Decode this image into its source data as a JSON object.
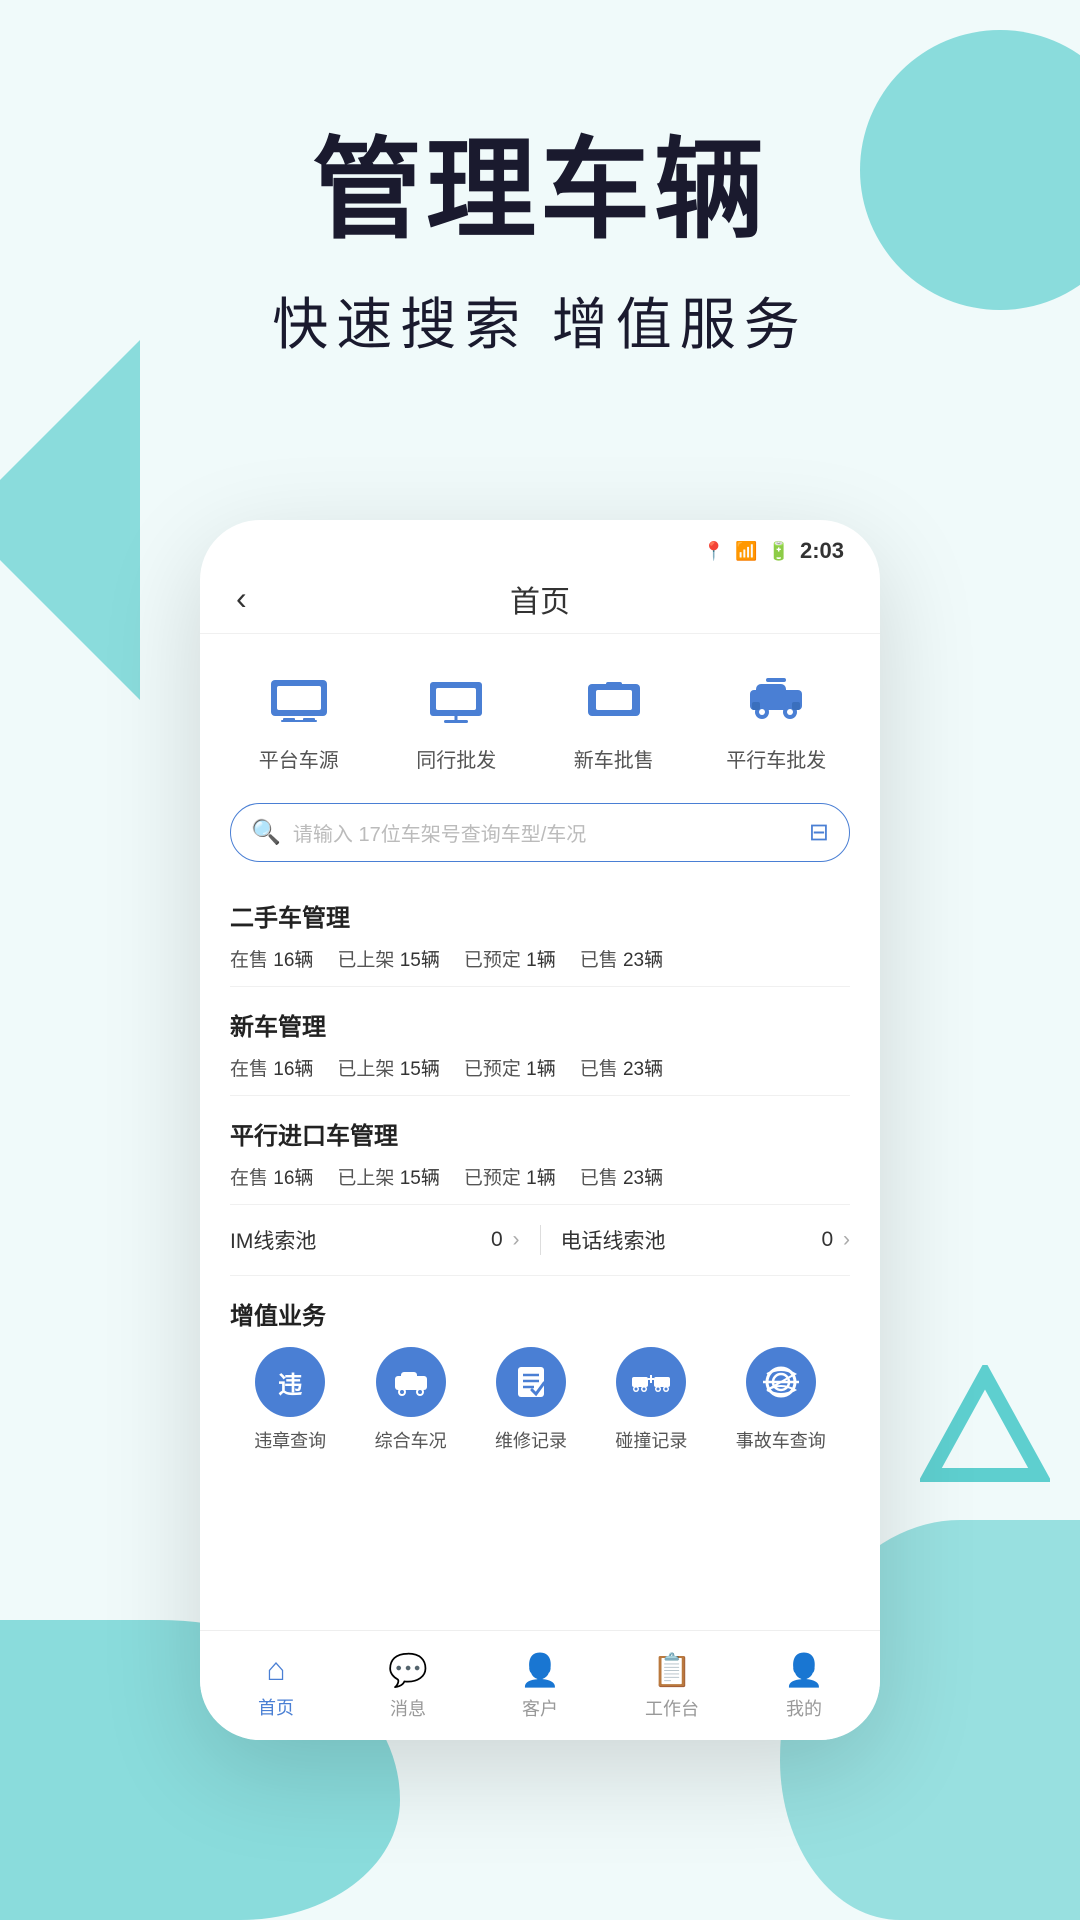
{
  "hero": {
    "title": "管理车辆",
    "subtitle": "快速搜索 增值服务"
  },
  "phone": {
    "statusBar": {
      "time": "2:03"
    },
    "navBar": {
      "title": "首页",
      "backLabel": "‹"
    },
    "quickAccess": [
      {
        "id": "platform-car",
        "label": "平台车源"
      },
      {
        "id": "peer-wholesale",
        "label": "同行批发"
      },
      {
        "id": "new-car-retail",
        "label": "新车批售"
      },
      {
        "id": "parallel-car-wholesale",
        "label": "平行车批发"
      }
    ],
    "searchBar": {
      "placeholder": "请输入 17位车架号查询车型/车况"
    },
    "sections": {
      "usedCar": {
        "title": "二手车管理",
        "stats": [
          {
            "label": "在售",
            "value": "16辆"
          },
          {
            "label": "已上架",
            "value": "15辆"
          },
          {
            "label": "已预定",
            "value": "1辆"
          },
          {
            "label": "已售",
            "value": "23辆"
          }
        ]
      },
      "newCar": {
        "title": "新车管理",
        "stats": [
          {
            "label": "在售",
            "value": "16辆"
          },
          {
            "label": "已上架",
            "value": "15辆"
          },
          {
            "label": "已预定",
            "value": "1辆"
          },
          {
            "label": "已售",
            "value": "23辆"
          }
        ]
      },
      "parallelImport": {
        "title": "平行进口车管理",
        "stats": [
          {
            "label": "在售",
            "value": "16辆"
          },
          {
            "label": "已上架",
            "value": "15辆"
          },
          {
            "label": "已预定",
            "value": "1辆"
          },
          {
            "label": "已售",
            "value": "23辆"
          }
        ]
      }
    },
    "leadPool": {
      "im": {
        "label": "IM线索池",
        "value": "0"
      },
      "phone": {
        "label": "电话线索池",
        "value": "0"
      }
    },
    "valueServices": {
      "title": "增值业务",
      "items": [
        {
          "id": "violation",
          "label": "违章查询",
          "icon": "违"
        },
        {
          "id": "overall",
          "label": "综合车况",
          "icon": "🚗"
        },
        {
          "id": "maintenance",
          "label": "维修记录",
          "icon": "📋"
        },
        {
          "id": "collision",
          "label": "碰撞记录",
          "icon": "💥"
        },
        {
          "id": "accident",
          "label": "事故车查询",
          "icon": "🔍"
        }
      ]
    },
    "bottomNav": [
      {
        "id": "home",
        "label": "首页",
        "active": true
      },
      {
        "id": "message",
        "label": "消息",
        "active": false
      },
      {
        "id": "customer",
        "label": "客户",
        "active": false
      },
      {
        "id": "workbench",
        "label": "工作台",
        "active": false
      },
      {
        "id": "mine",
        "label": "我的",
        "active": false
      }
    ]
  }
}
